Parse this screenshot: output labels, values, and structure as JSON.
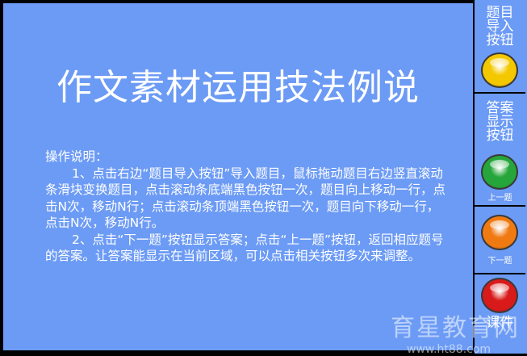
{
  "title": "作文素材运用技法例说",
  "instructions": {
    "heading": "操作说明：",
    "para1": "1、点击右边“题目导入按钮”导入题目，鼠标拖动题目右边竖直滚动条滑块变换题目，点击滚动条底端黑色按钮一次，题目向上移动一行，点击N次，移动N行；点击滚动条顶端黑色按钮一次，题目向下移动一行，点击N次，移动N行。",
    "para2": "2、点击“下一题”按钮显示答案；点击“上一题”按钮，返回相应题号的答案。让答案能显示在当前区域，可以点击相关按钮多次来调整。"
  },
  "sidebar": {
    "import": {
      "label_l1": "题目",
      "label_l2": "导入",
      "label_l3": "按钮",
      "icon": "yellow-round-button-icon",
      "color": "#f4c800"
    },
    "answer": {
      "label_l1": "答案",
      "label_l2": "显示",
      "label_l3": "按钮",
      "icon": "green-round-button-icon",
      "color": "#26a63a"
    },
    "prev": {
      "label": "上一题",
      "icon": "green-round-button-icon",
      "color": "#26a63a"
    },
    "next": {
      "label": "下一题",
      "icon": "orange-round-button-icon",
      "color": "#f07a12"
    },
    "course": {
      "label_l1": "课件",
      "label_l2": "",
      "icon": "red-round-button-icon",
      "color": "#d81a1a"
    }
  },
  "watermark": {
    "text": "育星教育网",
    "url": "www.ht88.com"
  }
}
